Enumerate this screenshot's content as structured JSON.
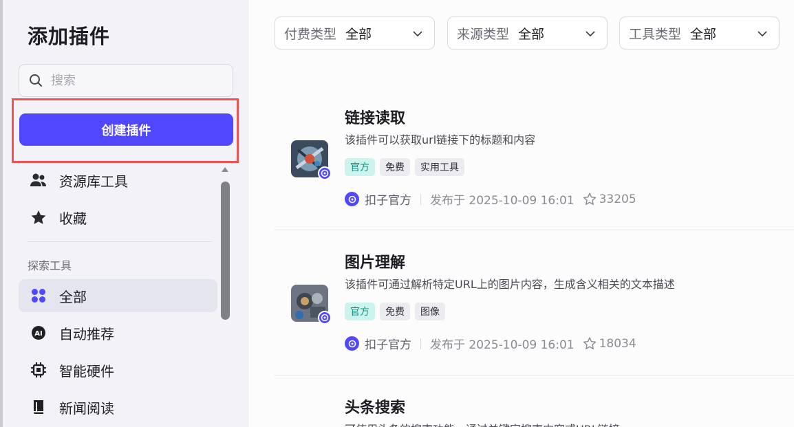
{
  "sidebar": {
    "title": "添加插件",
    "search_placeholder": "搜索",
    "create_button": "创建插件",
    "items": [
      {
        "label": "资源库工具",
        "icon": "users-icon"
      },
      {
        "label": "收藏",
        "icon": "star-icon"
      }
    ],
    "section_label": "探索工具",
    "explore_items": [
      {
        "label": "全部",
        "icon": "grid-icon",
        "active": true
      },
      {
        "label": "自动推荐",
        "icon": "ai-icon"
      },
      {
        "label": "智能硬件",
        "icon": "chip-icon"
      },
      {
        "label": "新闻阅读",
        "icon": "book-icon"
      }
    ]
  },
  "filters": [
    {
      "label": "付费类型",
      "value": "全部"
    },
    {
      "label": "来源类型",
      "value": "全部"
    },
    {
      "label": "工具类型",
      "value": "全部"
    }
  ],
  "plugins": [
    {
      "name": "链接读取",
      "description": "该插件可以获取url链接下的标题和内容",
      "tags": [
        "官方",
        "免费",
        "实用工具"
      ],
      "author": "扣子官方",
      "published": "发布于 2025-10-09 16:01",
      "stars": "33205"
    },
    {
      "name": "图片理解",
      "description": "该插件可通过解析特定URL上的图片内容，生成含义相关的文本描述",
      "tags": [
        "官方",
        "免费",
        "图像"
      ],
      "author": "扣子官方",
      "published": "发布于 2025-10-09 16:01",
      "stars": "18034"
    },
    {
      "name": "头条搜索",
      "description": "可使用头条的搜索功能，通过关键字搜索内容或URL链接"
    }
  ],
  "colors": {
    "accent": "#5147ff",
    "highlight": "#ef5354",
    "official_tag_bg": "#cdf3ee",
    "official_tag_text": "#118f7e"
  }
}
